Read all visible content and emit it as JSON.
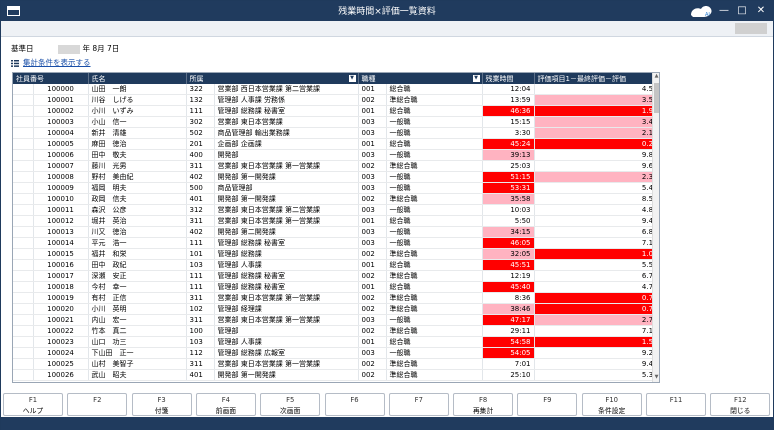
{
  "window": {
    "title": "残業時間×評価一覧資料"
  },
  "info": {
    "date_label": "基準日",
    "date_value": "年 8月 7日",
    "link_text": "集計条件を表示する"
  },
  "table": {
    "headers": [
      "社員番号",
      "氏名",
      "所属",
      "職種",
      "残業時間",
      "評価項目1－最終評価－評価"
    ],
    "rows": [
      [
        "100000",
        "山田　一朗",
        "322",
        "営業部 西日本営業課 第二営業課",
        "001",
        "総合職",
        "12:04",
        "4.50"
      ],
      [
        "100001",
        "川谷　しげる",
        "132",
        "管理部 人事課 労務係",
        "002",
        "準総合職",
        "13:59",
        "3.50"
      ],
      [
        "100002",
        "小川　いずみ",
        "111",
        "管理部 総務課 秘書室",
        "001",
        "総合職",
        "46:36",
        "1.90"
      ],
      [
        "100003",
        "小山　信一",
        "302",
        "営業部 東日本営業課",
        "003",
        "一般職",
        "15:15",
        "3.40"
      ],
      [
        "100004",
        "新井　清雄",
        "502",
        "商品管理部 輸出業務課",
        "003",
        "一般職",
        "3:30",
        "2.10"
      ],
      [
        "100005",
        "麻田　徳治",
        "201",
        "企画部 企画課",
        "001",
        "総合職",
        "45:24",
        "0.20"
      ],
      [
        "100006",
        "田中　敬夫",
        "400",
        "開発部",
        "003",
        "一般職",
        "39:13",
        "9.80"
      ],
      [
        "100007",
        "藤川　光男",
        "311",
        "営業部 東日本営業課 第一営業課",
        "002",
        "準総合職",
        "25:03",
        "9.60"
      ],
      [
        "100008",
        "野村　美由紀",
        "402",
        "開発部 第一開発課",
        "003",
        "一般職",
        "51:15",
        "2.30"
      ],
      [
        "100009",
        "福岡　明夫",
        "500",
        "商品管理部",
        "003",
        "一般職",
        "53:31",
        "5.40"
      ],
      [
        "100010",
        "政岡　信夫",
        "401",
        "開発部 第一開発課",
        "002",
        "準総合職",
        "35:58",
        "8.50"
      ],
      [
        "100011",
        "森沢　公彦",
        "312",
        "営業部 東日本営業課 第二営業課",
        "003",
        "一般職",
        "10:03",
        "4.80"
      ],
      [
        "100012",
        "堀井　英治",
        "311",
        "営業部 東日本営業課 第一営業課",
        "001",
        "総合職",
        "5:50",
        "9.40"
      ],
      [
        "100013",
        "川又　徳治",
        "402",
        "開発部 第二開発課",
        "003",
        "一般職",
        "34:15",
        "6.80"
      ],
      [
        "100014",
        "平元　浩一",
        "111",
        "管理部 総務課 秘書室",
        "003",
        "一般職",
        "46:05",
        "7.10"
      ],
      [
        "100015",
        "福井　和栄",
        "101",
        "管理部 総務課",
        "002",
        "準総合職",
        "32:05",
        "1.00"
      ],
      [
        "100016",
        "田中　政紀",
        "103",
        "管理部 人事課",
        "001",
        "総合職",
        "45:51",
        "5.50"
      ],
      [
        "100017",
        "深瀬　安正",
        "111",
        "管理部 総務課 秘書室",
        "002",
        "準総合職",
        "12:19",
        "6.70"
      ],
      [
        "100018",
        "今村　幸一",
        "111",
        "管理部 総務課 秘書室",
        "001",
        "総合職",
        "45:40",
        "4.70"
      ],
      [
        "100019",
        "有村　正信",
        "311",
        "営業部 東日本営業課 第一営業課",
        "002",
        "準総合職",
        "8:36",
        "0.70"
      ],
      [
        "100020",
        "小川　英明",
        "102",
        "管理部 経理課",
        "002",
        "準総合職",
        "38:46",
        "0.70"
      ],
      [
        "100021",
        "内山　宏一",
        "311",
        "営業部 東日本営業課 第一営業課",
        "003",
        "一般職",
        "47:17",
        "2.70"
      ],
      [
        "100022",
        "竹本　真二",
        "100",
        "管理部",
        "002",
        "準総合職",
        "29:11",
        "7.10"
      ],
      [
        "100023",
        "山口　功三",
        "103",
        "管理部 人事課",
        "001",
        "総合職",
        "54:58",
        "1.50"
      ],
      [
        "100024",
        "下山田　正一",
        "112",
        "管理部 総務課 広報室",
        "003",
        "一般職",
        "54:05",
        "9.20"
      ],
      [
        "100025",
        "山村　美智子",
        "311",
        "営業部 東日本営業課 第一営業課",
        "002",
        "準総合職",
        "7:01",
        "9.40"
      ],
      [
        "100026",
        "武山　昭夫",
        "401",
        "開発部 第一開発課",
        "002",
        "準総合職",
        "25:10",
        "5.30"
      ]
    ],
    "overtime_levels": [
      "none",
      "none",
      "red",
      "none",
      "none",
      "red",
      "pink",
      "none",
      "red",
      "red",
      "pink",
      "none",
      "none",
      "pink",
      "red",
      "pink",
      "red",
      "none",
      "red",
      "none",
      "pink",
      "red",
      "none",
      "red",
      "red",
      "none",
      "none"
    ],
    "score_levels": [
      "none",
      "pink",
      "red",
      "pink",
      "pink",
      "red",
      "none",
      "none",
      "pink",
      "none",
      "none",
      "none",
      "none",
      "none",
      "none",
      "red",
      "none",
      "none",
      "none",
      "red",
      "red",
      "pink",
      "none",
      "red",
      "none",
      "none",
      "none"
    ]
  },
  "colors": {
    "header_bg": "#1f3a5c",
    "title_bg": "#203b5e",
    "red": "#ff0000",
    "pink": "#ffb3c1",
    "link": "#1a4fa8"
  },
  "fkeys": [
    {
      "key": "F1",
      "label": "ヘルプ"
    },
    {
      "key": "F2",
      "label": ""
    },
    {
      "key": "F3",
      "label": "付箋"
    },
    {
      "key": "F4",
      "label": "前画面"
    },
    {
      "key": "F5",
      "label": "次画面"
    },
    {
      "key": "F6",
      "label": ""
    },
    {
      "key": "F7",
      "label": ""
    },
    {
      "key": "F8",
      "label": "再集計"
    },
    {
      "key": "F9",
      "label": ""
    },
    {
      "key": "F10",
      "label": "条件設定"
    },
    {
      "key": "F11",
      "label": ""
    },
    {
      "key": "F12",
      "label": "閉じる"
    }
  ]
}
